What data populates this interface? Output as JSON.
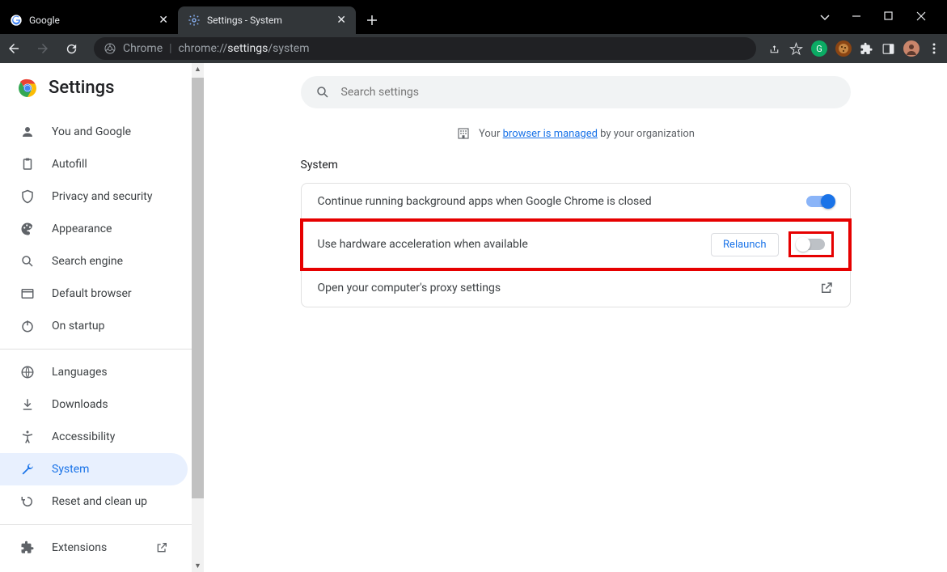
{
  "tabs": [
    {
      "label": "Google"
    },
    {
      "label": "Settings - System"
    }
  ],
  "url_prefix": "Chrome",
  "url_scheme": "chrome://",
  "url_bold": "settings",
  "url_rest": "/system",
  "brand_title": "Settings",
  "search_placeholder": "Search settings",
  "managed_prefix": "Your ",
  "managed_link": "browser is managed",
  "managed_suffix": " by your organization",
  "section_title": "System",
  "nav": [
    {
      "label": "You and Google"
    },
    {
      "label": "Autofill"
    },
    {
      "label": "Privacy and security"
    },
    {
      "label": "Appearance"
    },
    {
      "label": "Search engine"
    },
    {
      "label": "Default browser"
    },
    {
      "label": "On startup"
    },
    {
      "label": "Languages"
    },
    {
      "label": "Downloads"
    },
    {
      "label": "Accessibility"
    },
    {
      "label": "System"
    },
    {
      "label": "Reset and clean up"
    },
    {
      "label": "Extensions"
    }
  ],
  "rows": {
    "bg_apps": "Continue running background apps when Google Chrome is closed",
    "hw_accel": "Use hardware acceleration when available",
    "relaunch": "Relaunch",
    "proxy": "Open your computer's proxy settings"
  }
}
